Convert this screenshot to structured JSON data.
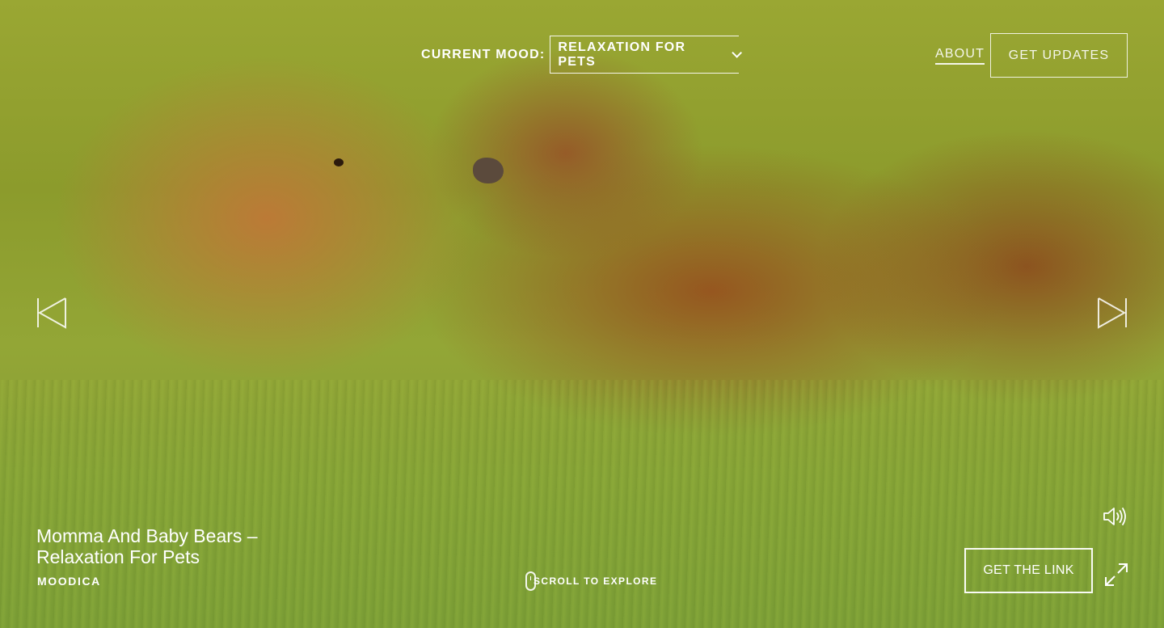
{
  "header": {
    "mood_label": "CURRENT MOOD:",
    "mood_value": "RELAXATION FOR PETS",
    "about_label": "ABOUT",
    "updates_label": "GET UPDATES"
  },
  "player": {
    "video_title": "Momma And Baby Bears – Relaxation For Pets",
    "channel": "MOODICA",
    "scroll_label": "SCROLL TO EXPLORE",
    "get_link_label": "GET THE LINK"
  },
  "icons": {
    "prev": "previous-arrow-icon",
    "next": "next-arrow-icon",
    "sound": "speaker-icon",
    "fullscreen": "fullscreen-icon",
    "mouse": "mouse-scroll-icon",
    "dropdown": "chevron-down-icon"
  },
  "colors": {
    "text": "#ffffff",
    "grass": "#8c9b2c",
    "bear": "#b0702f"
  }
}
